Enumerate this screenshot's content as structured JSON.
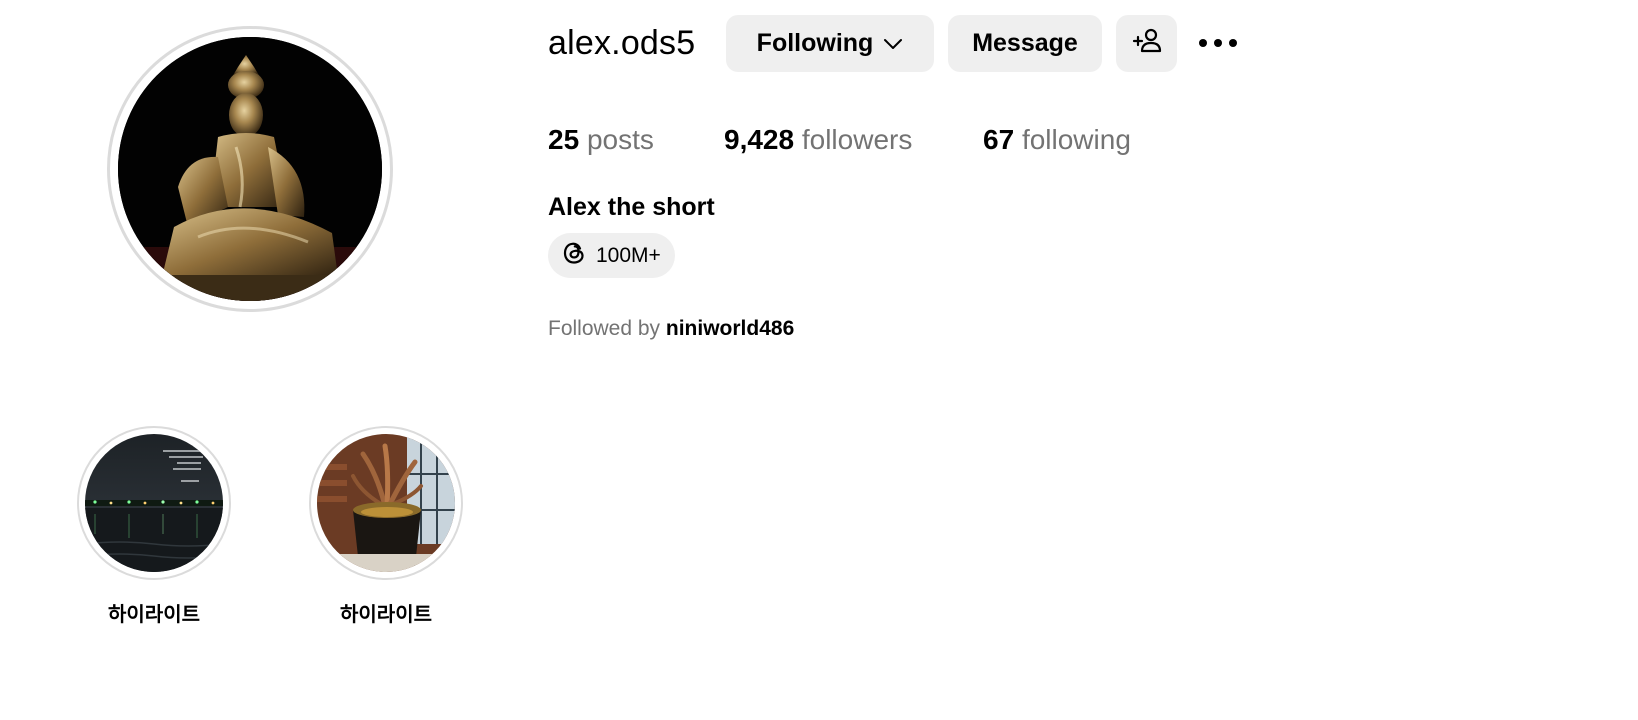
{
  "profile": {
    "username": "alex.ods5",
    "full_name": "Alex the short",
    "avatar_icon": "buddha-statue-photo"
  },
  "actions": {
    "following_label": "Following",
    "message_label": "Message",
    "suggest_icon": "add-person-icon",
    "more_icon": "more-options-icon"
  },
  "stats": {
    "posts": {
      "count": "25",
      "label": "posts"
    },
    "followers": {
      "count": "9,428",
      "label": "followers"
    },
    "following": {
      "count": "67",
      "label": "following"
    }
  },
  "threads": {
    "icon": "threads-icon",
    "count": "100M+"
  },
  "followed_by": {
    "prefix": "Followed by ",
    "user": "niniworld486"
  },
  "highlights": [
    {
      "label": "하이라이트",
      "icon": "night-river-photo"
    },
    {
      "label": "하이라이트",
      "icon": "wooden-sculpture-photo"
    }
  ],
  "colors": {
    "button_bg": "#efefef",
    "secondary_text": "#737373",
    "ring_border": "#dbdbdb"
  }
}
